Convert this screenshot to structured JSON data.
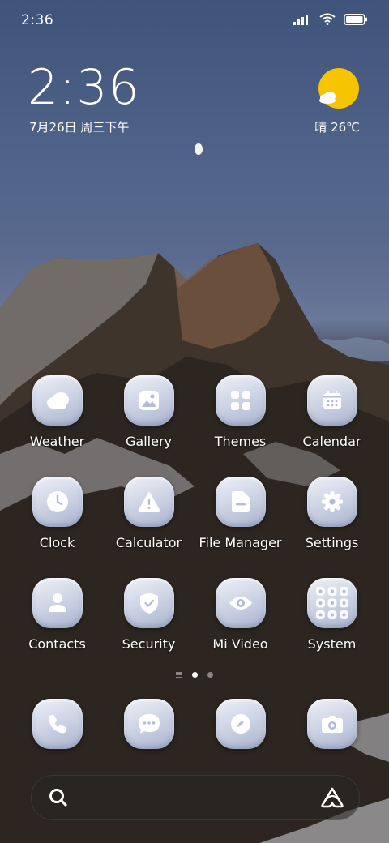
{
  "status": {
    "time": "2:36",
    "icons": [
      "signal-icon",
      "wifi-icon",
      "battery-icon"
    ]
  },
  "lockclock": {
    "time": "2:36",
    "date": "7月26日 周三下午"
  },
  "weather": {
    "text": "晴 26℃",
    "icon": "sun-cloud-icon"
  },
  "apps": [
    {
      "label": "Weather",
      "icon": "weather-icon"
    },
    {
      "label": "Gallery",
      "icon": "gallery-icon"
    },
    {
      "label": "Themes",
      "icon": "themes-icon"
    },
    {
      "label": "Calendar",
      "icon": "calendar-icon"
    },
    {
      "label": "Clock",
      "icon": "clock-icon"
    },
    {
      "label": "Calculator",
      "icon": "calculator-icon"
    },
    {
      "label": "File Manager",
      "icon": "file-manager-icon"
    },
    {
      "label": "Settings",
      "icon": "gear-icon"
    },
    {
      "label": "Contacts",
      "icon": "contacts-icon"
    },
    {
      "label": "Security",
      "icon": "shield-icon"
    },
    {
      "label": "Mi Video",
      "icon": "eye-icon"
    },
    {
      "label": "System",
      "icon": "folder-icon"
    }
  ],
  "pages": {
    "count": 2,
    "active": 1
  },
  "dock": [
    {
      "icon": "phone-icon"
    },
    {
      "icon": "messages-icon"
    },
    {
      "icon": "compass-icon"
    },
    {
      "icon": "camera-icon"
    }
  ],
  "searchbar": {
    "left_icon": "search-icon",
    "right_icon": "assistant-icon"
  },
  "colors": {
    "icon_bg": "#c9d0e2",
    "glyph": "#ffffff",
    "sun": "#f6c400"
  }
}
